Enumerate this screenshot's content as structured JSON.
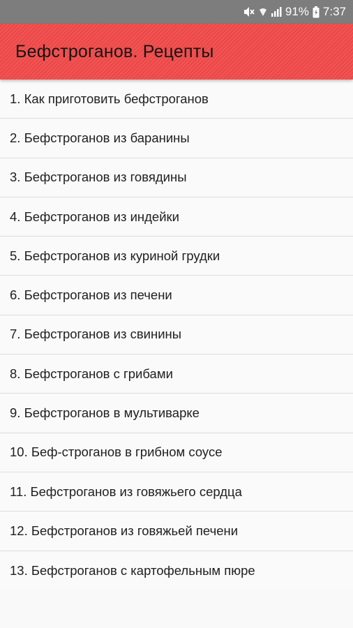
{
  "status_bar": {
    "battery": "91%",
    "time": "7:37",
    "icons": [
      "mute-icon",
      "wifi-icon",
      "signal-icon",
      "battery-charging-icon"
    ]
  },
  "app_bar": {
    "title": "Бефстроганов. Рецепты",
    "color": "#f24b4b"
  },
  "recipes": [
    "1. Как приготовить бефстроганов",
    "2. Бефстроганов из баранины",
    "3. Бефстроганов из говядины",
    "4. Бефстроганов из индейки",
    "5. Бефстроганов из куриной грудки",
    "6. Бефстроганов из печени",
    "7. Бефстроганов из свинины",
    "8. Бефстроганов с грибами",
    "9. Бефстроганов в мультиварке",
    "10. Беф-строганов в грибном соусе",
    "11. Бефстроганов из говяжьего сердца",
    "12. Бефстроганов из говяжьей печени",
    "13. Бефстроганов с картофельным пюре"
  ]
}
